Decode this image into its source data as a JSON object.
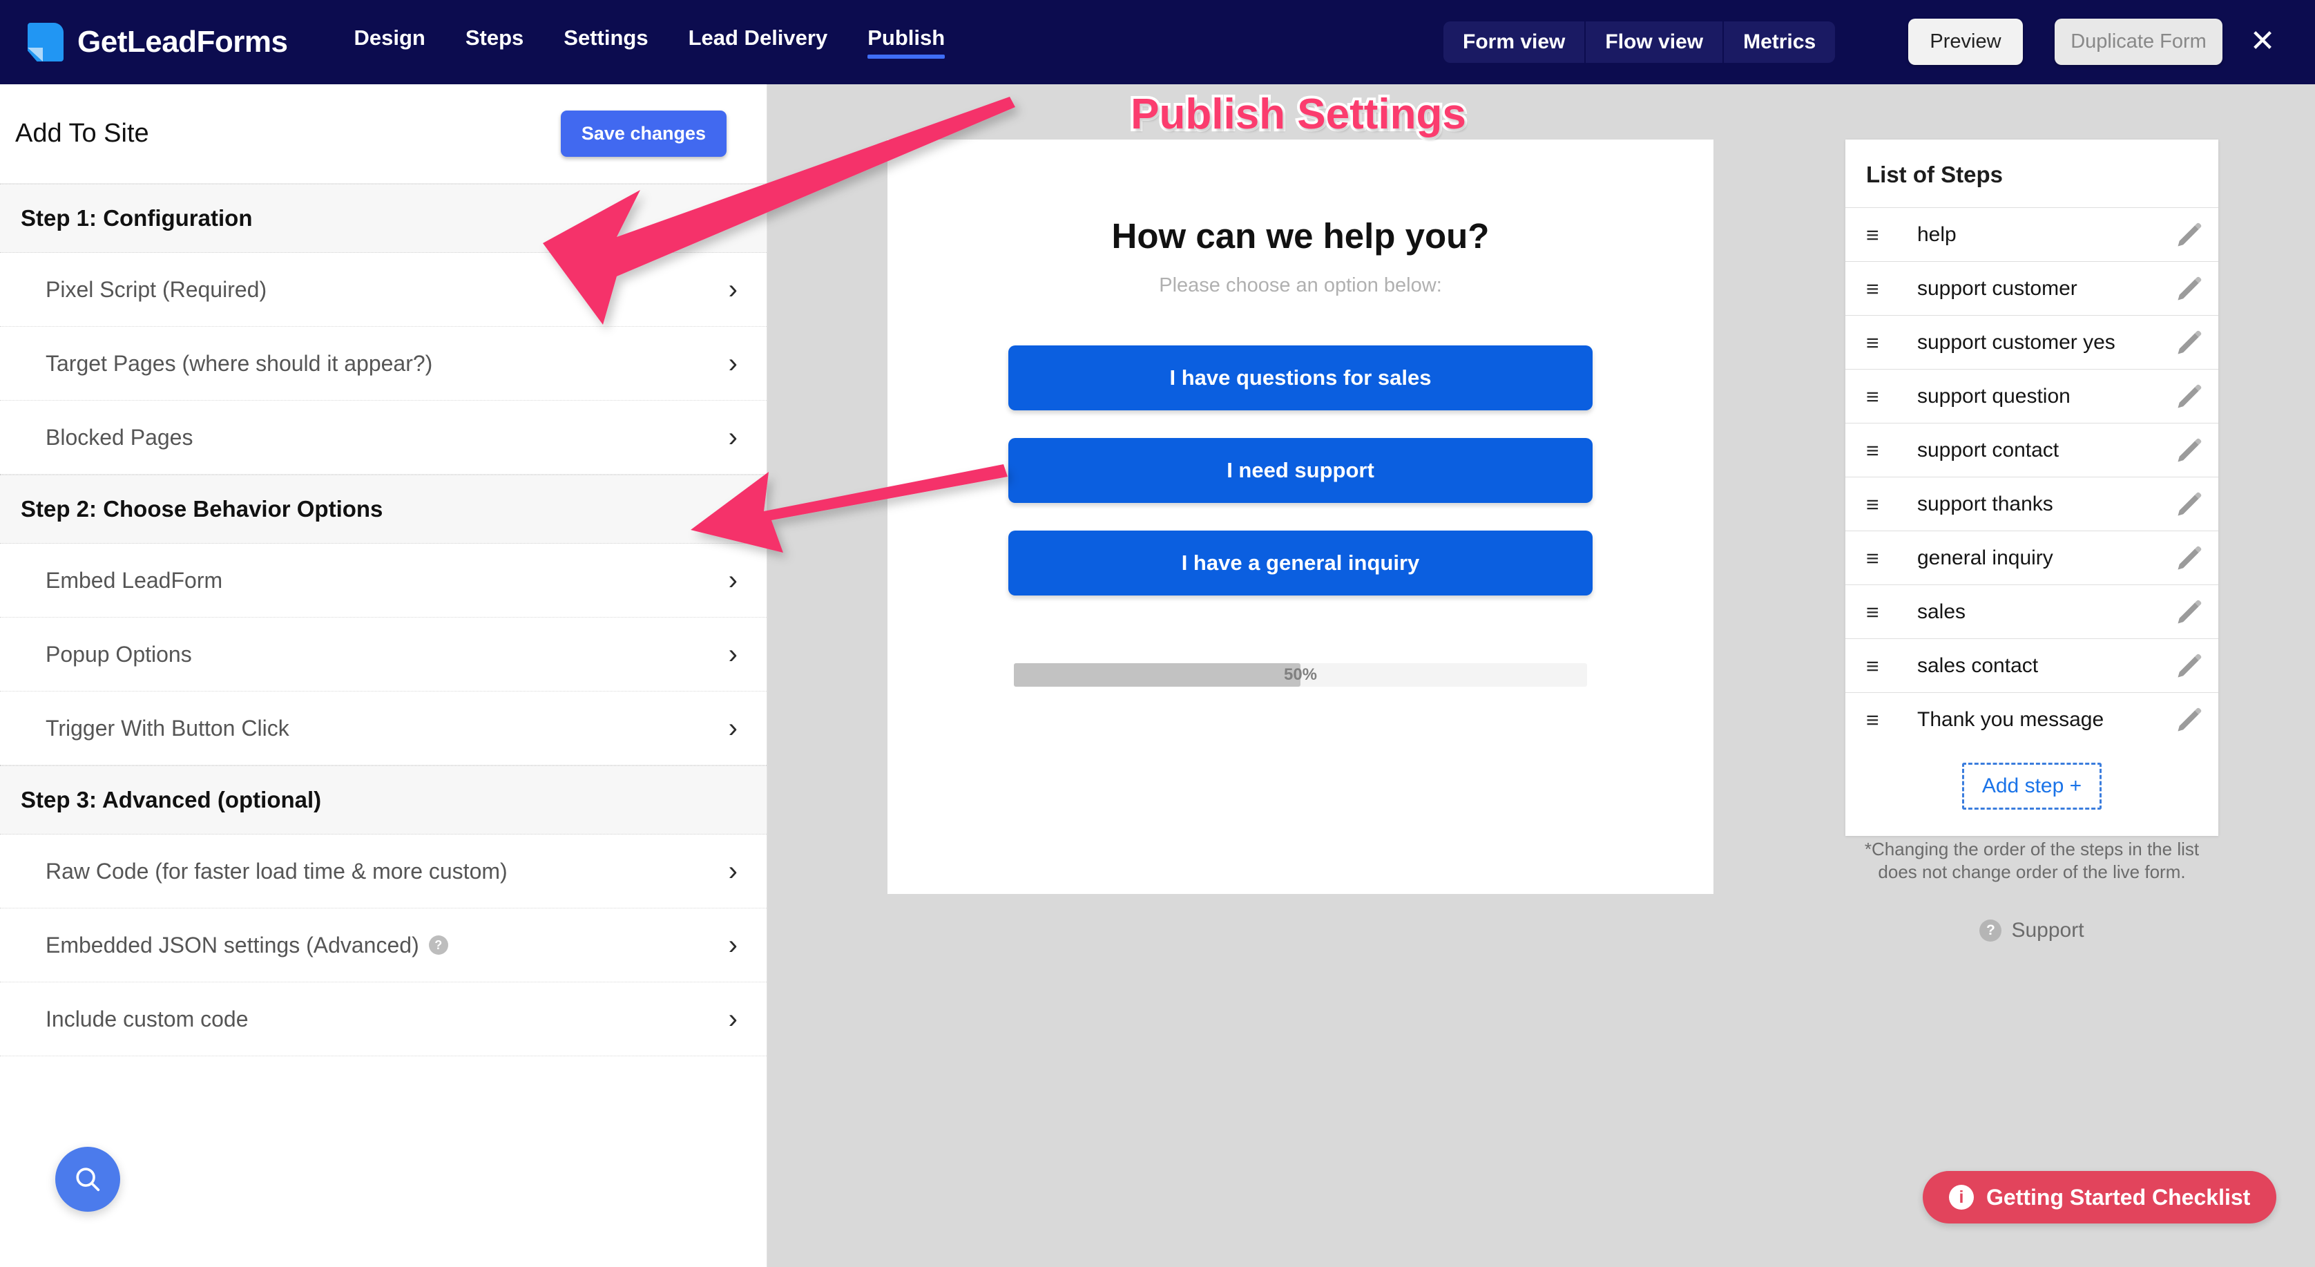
{
  "header": {
    "brand_name": "GetLeadForms",
    "nav": [
      {
        "label": "Design",
        "active": false
      },
      {
        "label": "Steps",
        "active": false
      },
      {
        "label": "Settings",
        "active": false
      },
      {
        "label": "Lead Delivery",
        "active": false
      },
      {
        "label": "Publish",
        "active": true
      }
    ],
    "view_toggle": [
      "Form view",
      "Flow view",
      "Metrics"
    ],
    "preview_label": "Preview",
    "duplicate_label": "Duplicate  Form",
    "close_label": "✕",
    "accent_color": "#0c0c4f",
    "active_underline_color": "#3f6ef5"
  },
  "sidebar": {
    "title": "Add To Site",
    "save_label": "Save  changes",
    "save_color": "#4169f0",
    "sections": [
      {
        "group": "Step 1: Configuration",
        "items": [
          {
            "label": "Pixel Script (Required)",
            "help": false
          },
          {
            "label": "Target Pages (where should it appear?)",
            "help": false
          },
          {
            "label": "Blocked Pages",
            "help": false
          }
        ]
      },
      {
        "group": "Step 2: Choose Behavior Options",
        "items": [
          {
            "label": "Embed LeadForm",
            "help": false
          },
          {
            "label": "Popup Options",
            "help": false
          },
          {
            "label": "Trigger With Button Click",
            "help": false
          }
        ]
      },
      {
        "group": "Step 3: Advanced (optional)",
        "items": [
          {
            "label": "Raw Code (for faster load time & more custom)",
            "help": false
          },
          {
            "label": "Embedded JSON settings (Advanced)",
            "help": true,
            "help_glyph": "?"
          },
          {
            "label": "Include custom code",
            "help": false
          }
        ]
      }
    ],
    "chevron_glyph": "›",
    "search_fab_icon": "search-icon"
  },
  "annotation": {
    "title": "Publish Settings",
    "title_color": "#fb3c6e",
    "arrow_color": "#f5336b"
  },
  "form_preview": {
    "heading": "How can we help you?",
    "subheading": "Please choose an option below:",
    "options": [
      "I have questions for sales",
      "I need support",
      "I have a general inquiry"
    ],
    "option_color": "#0b5fe0",
    "progress_percent": 50,
    "progress_label": "50%"
  },
  "steps_panel": {
    "title": "List of Steps",
    "steps": [
      "help",
      "support customer",
      "support customer yes",
      "support question",
      "support contact",
      "support thanks",
      "general inquiry",
      "sales",
      "sales contact",
      "Thank you message"
    ],
    "grip_glyph": "≡",
    "edit_icon": "pencil-icon",
    "add_step_label": "Add step +",
    "note": "*Changing the order of the steps in the list does not change order of the live form.",
    "support_label": "Support",
    "support_glyph": "?"
  },
  "footer": {
    "checklist_label": "Getting Started Checklist",
    "checklist_color": "#e2445c",
    "checklist_icon": "info-icon"
  }
}
